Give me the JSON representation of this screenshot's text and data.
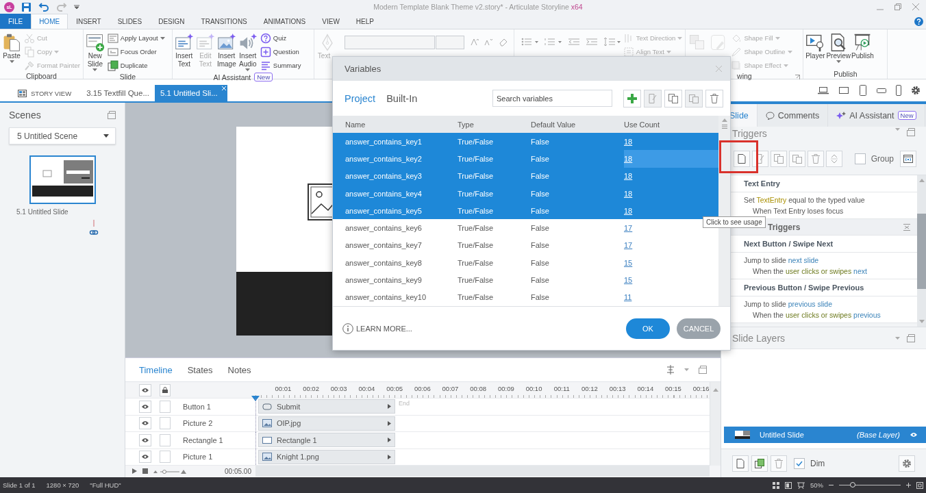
{
  "title_bar": {
    "logo": "sL",
    "title": "Modern Template Blank Theme v2.story* - Articulate Storyline",
    "edition": "x64"
  },
  "menu_tabs": [
    {
      "label": "FILE",
      "kind": "file",
      "selected": false
    },
    {
      "label": "HOME",
      "kind": "tab",
      "selected": true
    },
    {
      "label": "INSERT",
      "kind": "tab",
      "selected": false
    },
    {
      "label": "SLIDES",
      "kind": "tab",
      "selected": false
    },
    {
      "label": "DESIGN",
      "kind": "tab",
      "selected": false
    },
    {
      "label": "TRANSITIONS",
      "kind": "tab",
      "selected": false
    },
    {
      "label": "ANIMATIONS",
      "kind": "tab",
      "selected": false
    },
    {
      "label": "VIEW",
      "kind": "tab",
      "selected": false
    },
    {
      "label": "HELP",
      "kind": "tab",
      "selected": false
    }
  ],
  "ribbon": [
    {
      "label": "Clipboard",
      "big": [
        {
          "label": "Paste",
          "caret": true,
          "disabled": false
        }
      ],
      "small": [
        {
          "label": "Cut",
          "caret": false,
          "disabled": true
        },
        {
          "label": "Copy",
          "caret": true,
          "disabled": true
        },
        {
          "label": "Format Painter",
          "caret": false,
          "disabled": true
        }
      ]
    },
    {
      "label": "Slide",
      "big": [
        {
          "label": "New Slide",
          "caret": true,
          "disabled": false
        }
      ],
      "small": [
        {
          "label": "Apply Layout",
          "caret": true,
          "disabled": false
        },
        {
          "label": "Focus Order",
          "caret": false,
          "disabled": false
        },
        {
          "label": "Duplicate",
          "caret": false,
          "disabled": false
        }
      ]
    },
    {
      "label": "AI Assistant",
      "badge": "New",
      "big": [
        {
          "label": "Insert Text",
          "caret": false,
          "disabled": false
        },
        {
          "label": "Edit Text",
          "caret": false,
          "disabled": true
        },
        {
          "label": "Insert Image",
          "caret": false,
          "disabled": false
        },
        {
          "label": "Insert Audio",
          "caret": true,
          "disabled": false
        }
      ],
      "small": [
        {
          "label": "Quiz",
          "caret": false,
          "disabled": false
        },
        {
          "label": "Question",
          "caret": false,
          "disabled": false
        },
        {
          "label": "Summary",
          "caret": false,
          "disabled": false
        }
      ]
    },
    {
      "big": [
        {
          "label": "Text",
          "caret": false,
          "disabled": true
        }
      ]
    },
    {
      "small": [
        {
          "label": "Text Direction",
          "caret": true,
          "disabled": true
        },
        {
          "label": "Align Text",
          "caret": true,
          "disabled": true
        }
      ]
    },
    {
      "label": "wing",
      "big": [
        {
          "caret": false,
          "disabled": true
        },
        {
          "caret": false,
          "disabled": true
        }
      ],
      "small": [
        {
          "label": "Shape Fill",
          "caret": true,
          "disabled": true
        },
        {
          "label": "Shape Outline",
          "caret": true,
          "disabled": true
        },
        {
          "label": "Shape Effect",
          "caret": true,
          "disabled": true
        }
      ]
    },
    {
      "label": "Publish",
      "big": [
        {
          "label": "Player",
          "caret": false,
          "disabled": false
        },
        {
          "label": "Preview",
          "caret": true,
          "disabled": false
        },
        {
          "label": "Publish",
          "caret": false,
          "disabled": false
        }
      ]
    }
  ],
  "doc_tabs": [
    {
      "label": "STORY VIEW",
      "kind": "story",
      "selected": false
    },
    {
      "label": "3.15 Textfill Que...",
      "kind": "slide",
      "selected": false
    },
    {
      "label": "5.1 Untitled Sli...",
      "kind": "slide",
      "selected": true
    }
  ],
  "left_panel": {
    "title": "Scenes",
    "scene_select": "5 Untitled Scene",
    "slides": [
      {
        "label": "5.1 Untitled Slide",
        "selected": true
      }
    ]
  },
  "timeline": {
    "tabs": [
      {
        "label": "Timeline",
        "selected": true
      },
      {
        "label": "States",
        "selected": false
      },
      {
        "label": "Notes",
        "selected": false
      }
    ],
    "ticks": [
      "00:01",
      "00:02",
      "00:03",
      "00:04",
      "00:05",
      "00:06",
      "00:07",
      "00:08",
      "00:09",
      "00:10",
      "00:11",
      "00:12",
      "00:13",
      "00:14",
      "00:15",
      "00:16"
    ],
    "end_label": "End",
    "rows": [
      {
        "name": "Button 1",
        "visible": true,
        "locked": false,
        "bar": "Submit",
        "kind": "button"
      },
      {
        "name": "Picture 2",
        "visible": true,
        "locked": false,
        "bar": "OIP.jpg",
        "kind": "picture"
      },
      {
        "name": "Rectangle 1",
        "visible": true,
        "locked": false,
        "bar": "Rectangle 1",
        "kind": "shape"
      },
      {
        "name": "Picture 1",
        "visible": true,
        "locked": false,
        "bar": "Knight 1.png",
        "kind": "picture"
      }
    ],
    "duration": "00:05.00"
  },
  "right_panel": {
    "tabs": [
      {
        "label": "Slide",
        "selected": true
      },
      {
        "label": "Comments",
        "selected": false
      },
      {
        "label": "AI Assistant",
        "badge": "New",
        "selected": false
      }
    ],
    "triggers_title": "Triggers",
    "group_label": "Group",
    "group_checked": false,
    "trigger_groups": [
      {
        "kind": "object",
        "title": "Text Entry",
        "triggers": [
          {
            "action": [
              {
                "kind": "text",
                "text": "Set "
              },
              {
                "kind": "variable",
                "text": "TextEntry"
              },
              {
                "kind": "text",
                "text": " equal to the typed value"
              }
            ],
            "condition": [
              {
                "kind": "text",
                "text": "When Text Entry loses focus"
              }
            ]
          }
        ]
      },
      {
        "kind": "header",
        "title": "Triggers"
      },
      {
        "kind": "object",
        "title": "Next Button / Swipe Next",
        "triggers": [
          {
            "action": [
              {
                "kind": "text",
                "text": "Jump to slide "
              },
              {
                "kind": "value",
                "text": "next slide"
              }
            ],
            "condition": [
              {
                "kind": "text",
                "text": "When the "
              },
              {
                "kind": "event",
                "text": "user clicks or swipes "
              },
              {
                "kind": "value",
                "text": "next"
              }
            ]
          }
        ]
      },
      {
        "kind": "object",
        "title": "Previous Button / Swipe Previous",
        "triggers": [
          {
            "action": [
              {
                "kind": "text",
                "text": "Jump to slide "
              },
              {
                "kind": "value",
                "text": "previous slide"
              }
            ],
            "condition": [
              {
                "kind": "text",
                "text": "When the "
              },
              {
                "kind": "event",
                "text": "user clicks or swipes "
              },
              {
                "kind": "value",
                "text": "previous"
              }
            ]
          }
        ]
      }
    ],
    "layers_title": "Slide Layers",
    "layers": [
      {
        "name": "Untitled Slide",
        "tag": "(Base Layer)",
        "selected": true
      }
    ],
    "dim_label": "Dim",
    "dim_checked": true
  },
  "variables_dialog": {
    "title": "Variables",
    "tabs": [
      {
        "label": "Project",
        "selected": true
      },
      {
        "label": "Built-In",
        "selected": false
      }
    ],
    "search": {
      "placeholder": "Search variables"
    },
    "columns": [
      "Name",
      "Type",
      "Default Value",
      "Use Count"
    ],
    "rows": [
      {
        "name": "answer_contains_key1",
        "type": "True/False",
        "default": "False",
        "count": "18",
        "selected": true,
        "hovered": false
      },
      {
        "name": "answer_contains_key2",
        "type": "True/False",
        "default": "False",
        "count": "18",
        "selected": true,
        "hovered": true
      },
      {
        "name": "answer_contains_key3",
        "type": "True/False",
        "default": "False",
        "count": "18",
        "selected": true,
        "hovered": false
      },
      {
        "name": "answer_contains_key4",
        "type": "True/False",
        "default": "False",
        "count": "18",
        "selected": true,
        "hovered": false
      },
      {
        "name": "answer_contains_key5",
        "type": "True/False",
        "default": "False",
        "count": "18",
        "selected": true,
        "hovered": false
      },
      {
        "name": "answer_contains_key6",
        "type": "True/False",
        "default": "False",
        "count": "17",
        "selected": false,
        "hovered": false
      },
      {
        "name": "answer_contains_key7",
        "type": "True/False",
        "default": "False",
        "count": "17",
        "selected": false,
        "hovered": false
      },
      {
        "name": "answer_contains_key8",
        "type": "True/False",
        "default": "False",
        "count": "15",
        "selected": false,
        "hovered": false
      },
      {
        "name": "answer_contains_key9",
        "type": "True/False",
        "default": "False",
        "count": "15",
        "selected": false,
        "hovered": false
      },
      {
        "name": "answer_contains_key10",
        "type": "True/False",
        "default": "False",
        "count": "11",
        "selected": false,
        "hovered": false
      }
    ],
    "learn_more": "LEARN MORE...",
    "buttons": [
      {
        "label": "OK",
        "kind": "primary"
      },
      {
        "label": "CANCEL",
        "kind": "secondary"
      }
    ]
  },
  "tooltip": "Click to see usage",
  "status_bar": {
    "slide": "Slide 1 of 1",
    "size": "1280 × 720",
    "player": "\"Full HUD\"",
    "zoom": "50%",
    "zoom_slider": {
      "level": 0.22
    }
  }
}
